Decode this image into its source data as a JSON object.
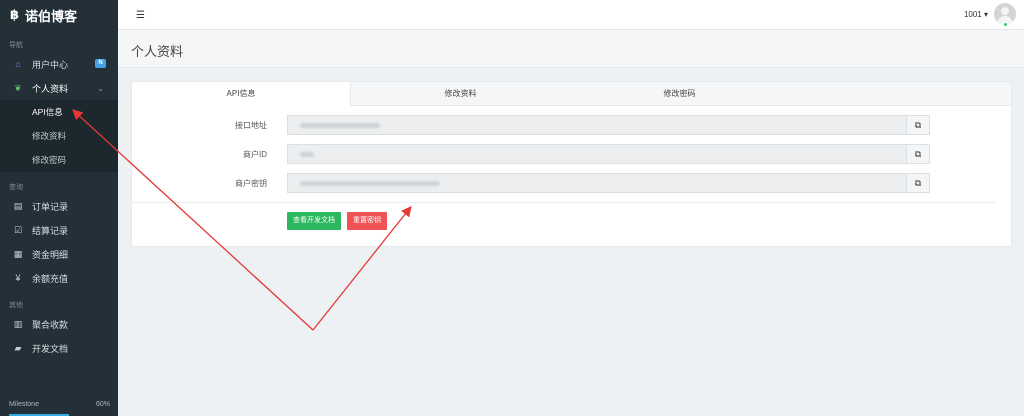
{
  "sidebar": {
    "brand": "诺伯博客",
    "sections": {
      "nav": "导航",
      "query": "查询",
      "other": "其他"
    },
    "items": {
      "user_center": "用户中心",
      "user_center_badge": "N",
      "profile": "个人资料",
      "orders": "订单记录",
      "settlement": "结算记录",
      "funds": "资金明细",
      "recharge": "余额充值",
      "aggregate": "聚合收款",
      "docs": "开发文档"
    },
    "sub_items": [
      "API信息",
      "修改资料",
      "修改密码"
    ],
    "milestone": {
      "label": "Milestone",
      "value": "60%",
      "progress": 0.6
    }
  },
  "topbar": {
    "user": "1001 ▾"
  },
  "page": {
    "title": "个人资料"
  },
  "tabs": [
    "API信息",
    "修改资料",
    "修改密码"
  ],
  "form": {
    "fields": [
      {
        "label": "接口地址"
      },
      {
        "label": "商户ID"
      },
      {
        "label": "商户密钥"
      }
    ],
    "buttons": {
      "docs": "查看开发文档",
      "reset": "重置密钥"
    }
  },
  "colors": {
    "sidebar": "#243038",
    "accent_green": "#2bb75d",
    "accent_red": "#ef5356",
    "arrow": "#e53935"
  }
}
